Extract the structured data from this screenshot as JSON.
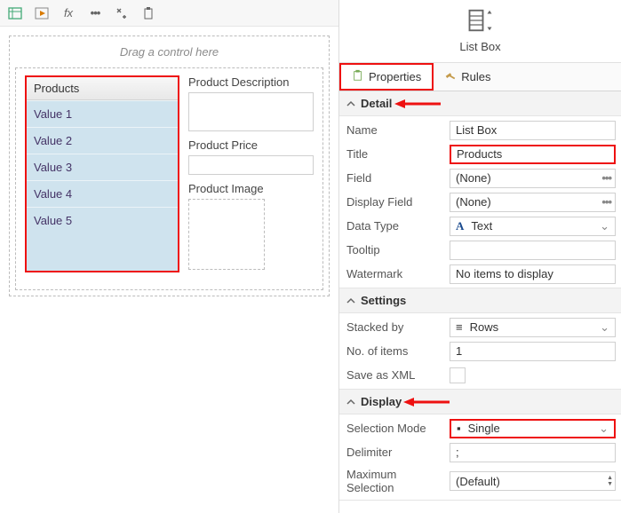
{
  "canvas": {
    "drag_hint": "Drag a control here",
    "listbox": {
      "header": "Products",
      "items": [
        "Value 1",
        "Value 2",
        "Value 3",
        "Value 4",
        "Value 5"
      ]
    },
    "fields": {
      "desc_label": "Product Description",
      "price_label": "Product Price",
      "image_label": "Product Image"
    }
  },
  "right": {
    "control_title": "List Box",
    "tabs": {
      "properties": "Properties",
      "rules": "Rules"
    },
    "sections": {
      "detail": "Detail",
      "settings": "Settings",
      "display": "Display"
    },
    "detail": {
      "name_label": "Name",
      "name_value": "List Box",
      "title_label": "Title",
      "title_value": "Products",
      "field_label": "Field",
      "field_value": "(None)",
      "display_field_label": "Display Field",
      "display_field_value": "(None)",
      "data_type_label": "Data Type",
      "data_type_value": "Text",
      "tooltip_label": "Tooltip",
      "tooltip_value": "",
      "watermark_label": "Watermark",
      "watermark_value": "No items to display"
    },
    "settings": {
      "stacked_label": "Stacked by",
      "stacked_value": "Rows",
      "noitems_label": "No. of items",
      "noitems_value": "1",
      "savexml_label": "Save as XML"
    },
    "display": {
      "selmode_label": "Selection Mode",
      "selmode_value": "Single",
      "delimiter_label": "Delimiter",
      "delimiter_value": ";",
      "maxsel_label": "Maximum Selection",
      "maxsel_value": "(Default)"
    }
  },
  "icons": {
    "data_type_glyph": "A"
  }
}
